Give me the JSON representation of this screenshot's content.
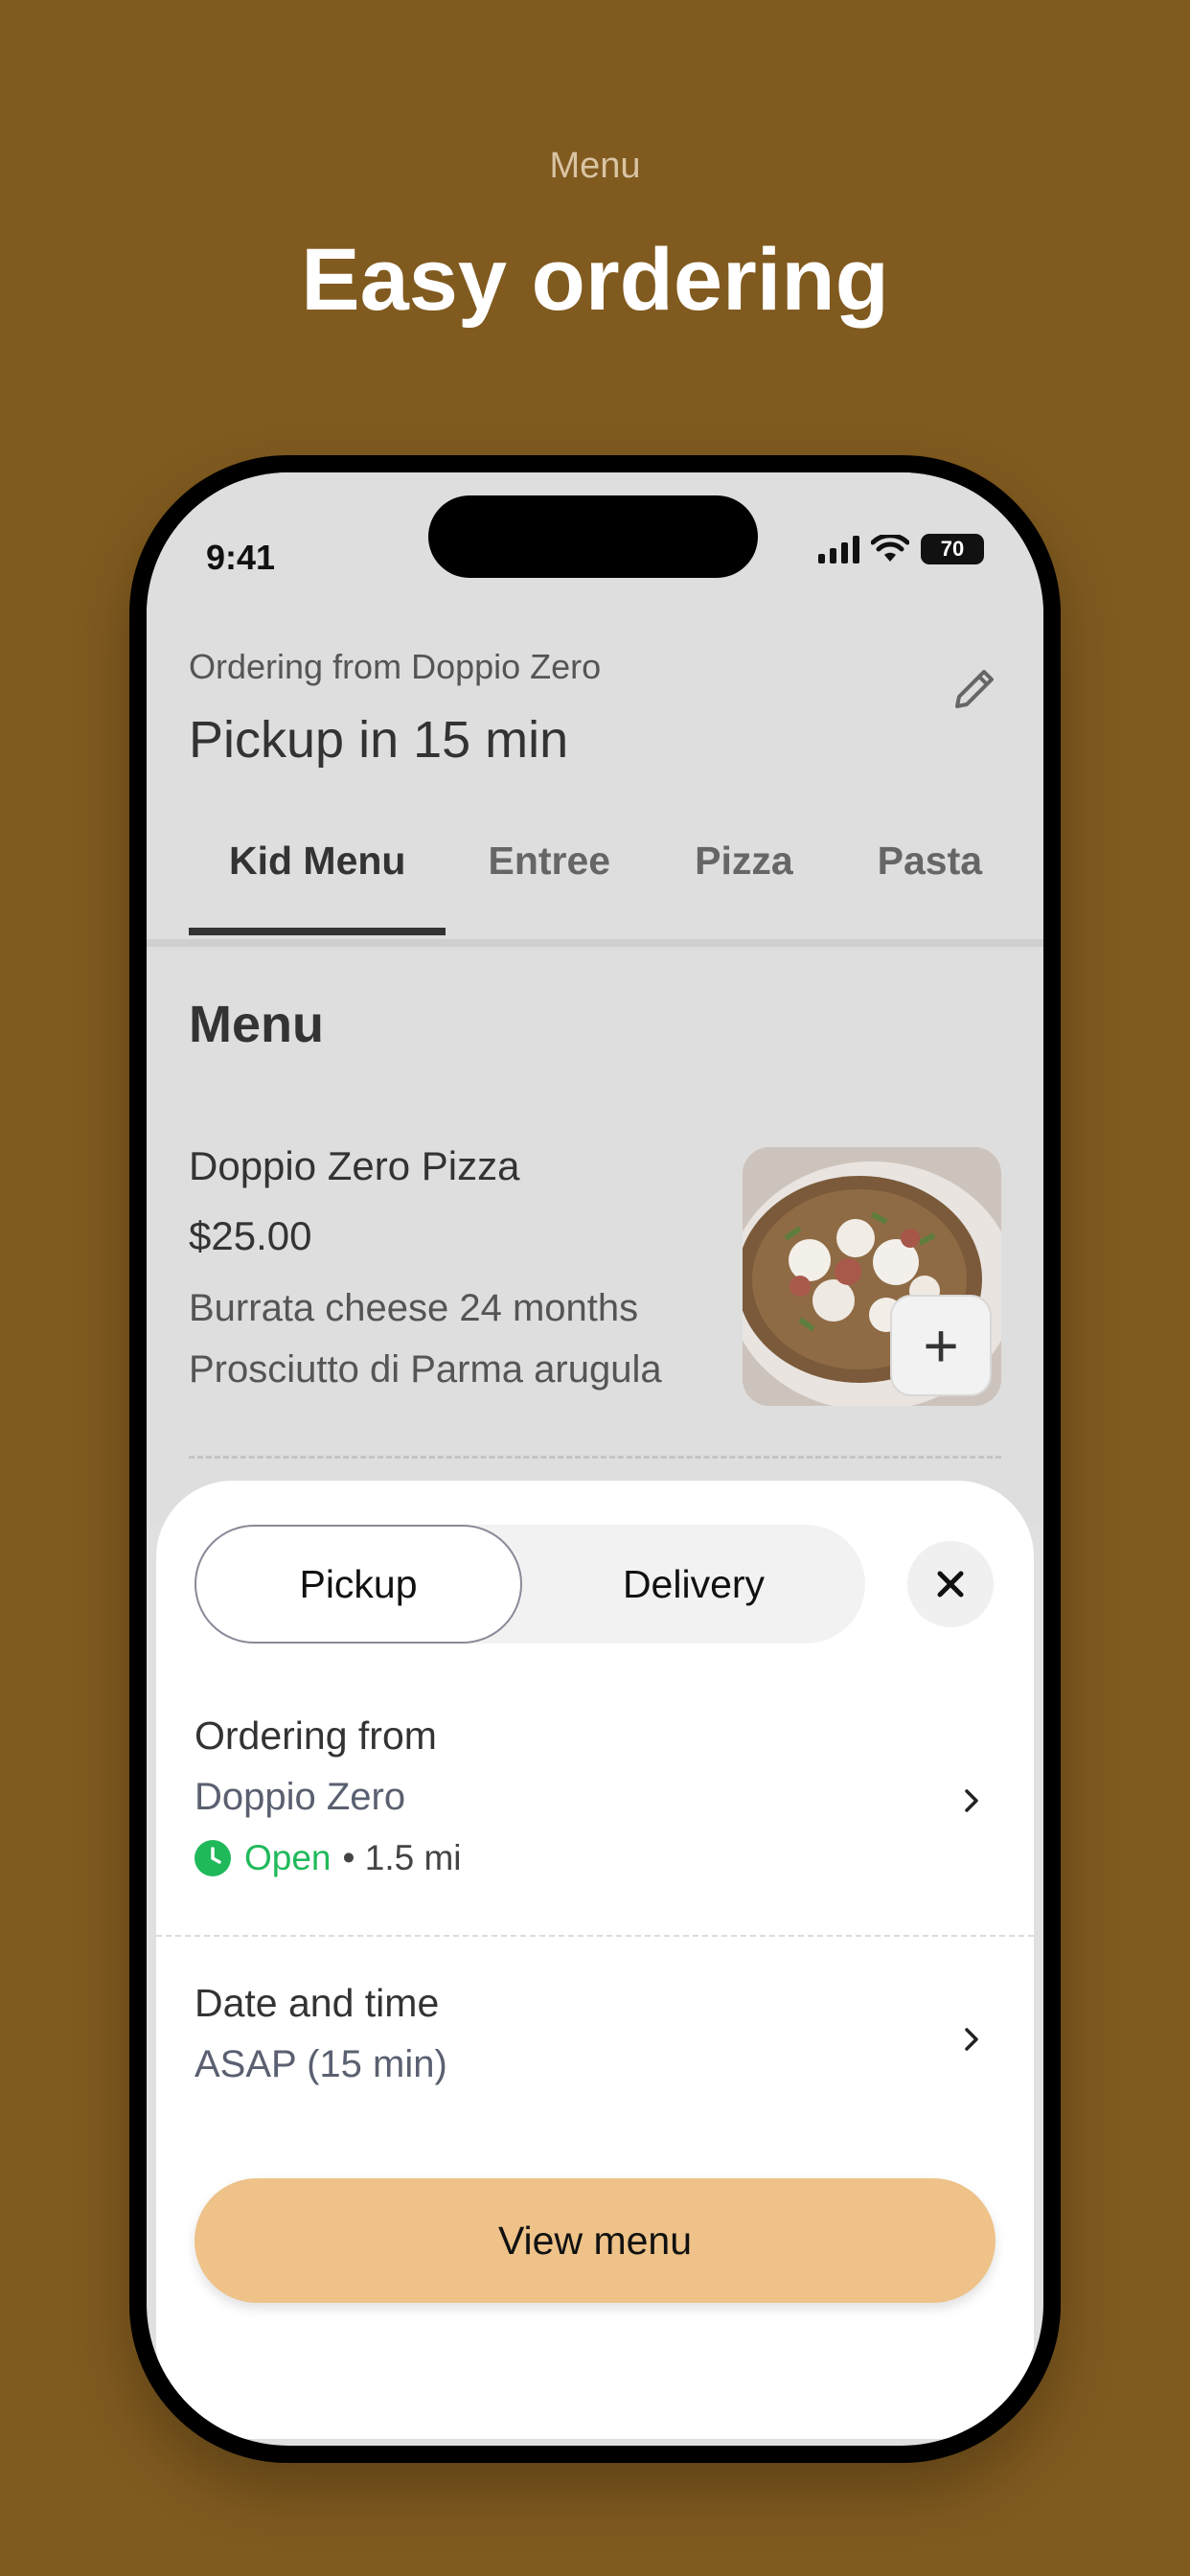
{
  "hero": {
    "eyebrow": "Menu",
    "title": "Easy ordering"
  },
  "status_bar": {
    "time": "9:41",
    "battery": "70"
  },
  "header": {
    "ordering_from": "Ordering from Doppio Zero",
    "pickup_time": "Pickup in 15 min",
    "edit_icon": "pencil-icon"
  },
  "tabs": [
    "Kid Menu",
    "Entree",
    "Pizza",
    "Pasta"
  ],
  "active_tab": "Kid Menu",
  "menu": {
    "section_title": "Menu",
    "items": [
      {
        "name": "Doppio Zero Pizza",
        "price": "$25.00",
        "description": "Burrata cheese 24 months Prosciutto di Parma arugula",
        "add_icon": "plus-icon"
      }
    ]
  },
  "sheet": {
    "mode_options": [
      "Pickup",
      "Delivery"
    ],
    "selected_mode": "Pickup",
    "close_icon": "close-icon",
    "ordering_from_label": "Ordering from",
    "store_name": "Doppio Zero",
    "status": "Open",
    "distance": "• 1.5 mi",
    "date_time_label": "Date and time",
    "date_time_value": "ASAP (15 min)",
    "cta": "View menu"
  },
  "colors": {
    "background": "#805a1f",
    "accent": "#eec288",
    "open_green": "#1fb95a"
  }
}
